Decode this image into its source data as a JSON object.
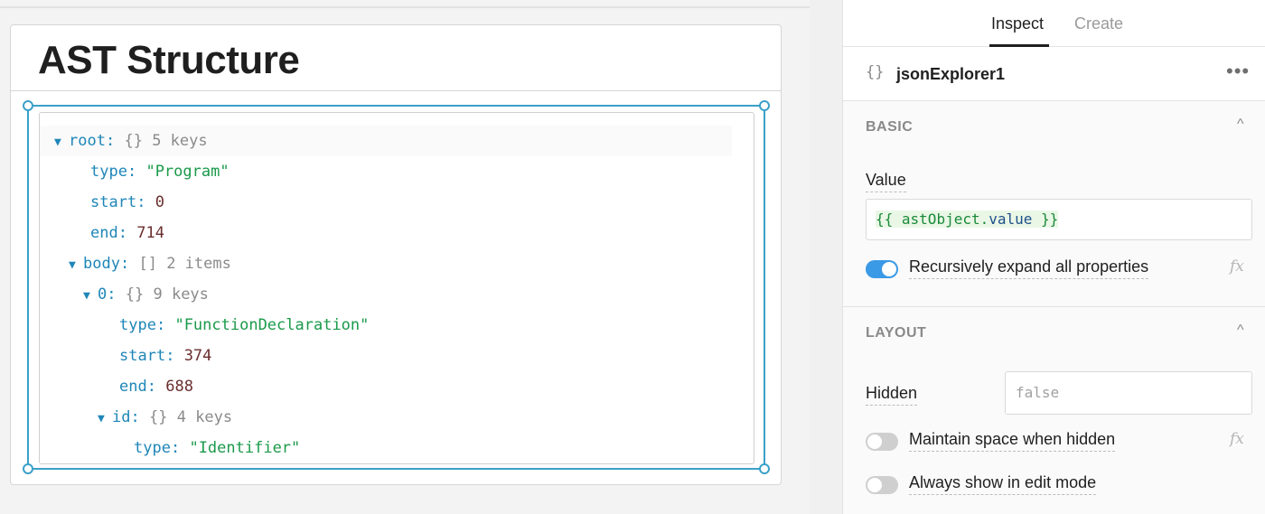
{
  "canvas": {
    "title": "AST Structure",
    "json_explorer": {
      "rows": [
        {
          "caret": "▼",
          "key": "root",
          "punct": ":",
          "bracket": "{}",
          "meta": "5 keys"
        },
        {
          "key": "type",
          "punct": ":",
          "value": "\"Program\"",
          "value_type": "string"
        },
        {
          "key": "start",
          "punct": ":",
          "value": "0",
          "value_type": "number"
        },
        {
          "key": "end",
          "punct": ":",
          "value": "714",
          "value_type": "number"
        },
        {
          "caret": "▼",
          "key": "body",
          "punct": ":",
          "bracket": "[]",
          "meta": "2 items"
        },
        {
          "caret": "▼",
          "key": "0",
          "punct": ":",
          "bracket": "{}",
          "meta": "9 keys"
        },
        {
          "key": "type",
          "punct": ":",
          "value": "\"FunctionDeclaration\"",
          "value_type": "string"
        },
        {
          "key": "start",
          "punct": ":",
          "value": "374",
          "value_type": "number"
        },
        {
          "key": "end",
          "punct": ":",
          "value": "688",
          "value_type": "number"
        },
        {
          "caret": "▼",
          "key": "id",
          "punct": ":",
          "bracket": "{}",
          "meta": "4 keys"
        },
        {
          "key": "type",
          "punct": ":",
          "value": "\"Identifier\"",
          "value_type": "string"
        }
      ]
    }
  },
  "inspector": {
    "tabs": {
      "inspect": "Inspect",
      "create": "Create"
    },
    "component": {
      "icon": "{}",
      "icon_name": "braces-icon",
      "name": "jsonExplorer1",
      "more": "•••"
    },
    "basic": {
      "header": "BASIC",
      "value_label": "Value",
      "value": {
        "open": "{{ ",
        "obj": "astObject.",
        "prop": "value",
        "close": " }}"
      },
      "recursive_label": "Recursively expand all properties",
      "recursive_on": true
    },
    "layout": {
      "header": "LAYOUT",
      "hidden_label": "Hidden",
      "hidden_placeholder": "false",
      "maintain_label": "Maintain space when hidden",
      "maintain_on": false,
      "always_label": "Always show in edit mode",
      "always_on": false
    },
    "fx": "fx",
    "chevron": "^"
  },
  "colors": {
    "accent": "#3aa0c9",
    "toggle_on": "#3b9ae6",
    "json_key": "#1e86b8",
    "json_string": "#1a9a4a",
    "json_number": "#6b2e2e"
  }
}
